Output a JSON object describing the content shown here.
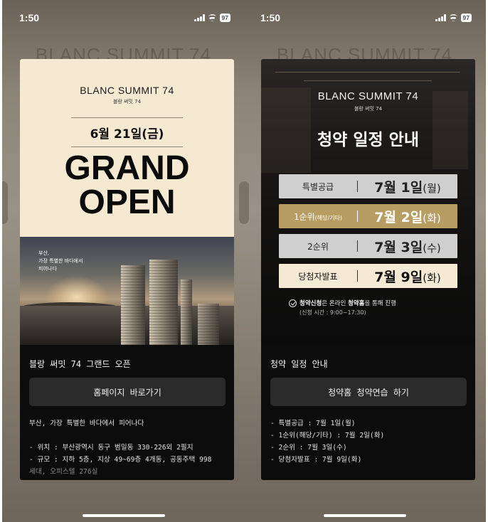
{
  "status": {
    "time": "1:50",
    "battery": "97"
  },
  "ghost_text": "BLANC SUMMIT 74",
  "left": {
    "brand_title": "BLANC SUMMIT 74",
    "brand_sub": "블랑 써밋 74",
    "date": "6월 21일(금)",
    "headline_1": "GRAND",
    "headline_2": "OPEN",
    "photo_caption": [
      "부산,",
      "가장 특별한 바다에서",
      "피어나다"
    ],
    "title": "블랑 써밋 74 그랜드 오픈",
    "button_label": "홈페이지 바로가기",
    "lines": [
      "부산, 가장 특별한 바다에서 피어나다",
      "- 위치 : 부산광역시 동구 범일동 330-226외 2필지",
      "- 규모 : 지하 5층, 지상 49~69층 4개동, 공동주택 998",
      "세대, 오피스텔 276실"
    ]
  },
  "right": {
    "brand_title": "BLANC SUMMIT 74",
    "brand_sub": "블랑 써밋 74",
    "heading": "청약 일정 안내",
    "schedule": [
      {
        "label": "특별공급",
        "label_small": "",
        "date_main": "7월 1일",
        "date_day": "(월)",
        "style": "gray"
      },
      {
        "label": "1순위",
        "label_small": "(해당/기타)",
        "date_main": "7월 2일",
        "date_day": "(화)",
        "style": "gold"
      },
      {
        "label": "2순위",
        "label_small": "",
        "date_main": "7월 3일",
        "date_day": "(수)",
        "style": "gray"
      },
      {
        "label": "당첨자발표",
        "label_small": "",
        "date_main": "7월 9일",
        "date_day": "(화)",
        "style": "cream"
      }
    ],
    "note_bold_1": "청약신청",
    "note_text_1": "은 온라인 ",
    "note_bold_2": "청약홈",
    "note_text_2": "을 통해 진행",
    "note_sub": "(신청 시간 : 9:00~17:30)",
    "title": "청약 일정 안내",
    "button_label": "청약홈 청약연습 하기",
    "lines": [
      "- 특별공급 : 7월 1일(월)",
      "- 1순위(해당/기타) : 7월 2일(화)",
      "- 2순위 : 7월 3일(수)",
      "- 당첨자발표 : 7월 9일(화)"
    ]
  },
  "colors": {
    "cream": "#f5ead1",
    "gold": "#b79d62",
    "card_bg": "#0c0c0c",
    "button_bg": "#2b2b2b"
  }
}
